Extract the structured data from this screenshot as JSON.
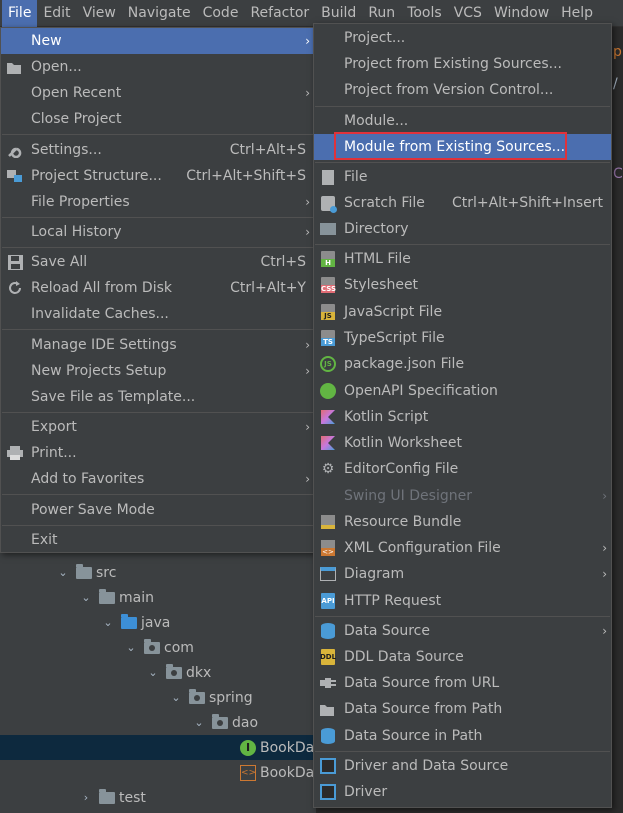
{
  "menubar": [
    {
      "label": "File",
      "active": true
    },
    {
      "label": "Edit"
    },
    {
      "label": "View"
    },
    {
      "label": "Navigate"
    },
    {
      "label": "Code"
    },
    {
      "label": "Refactor"
    },
    {
      "label": "Build"
    },
    {
      "label": "Run"
    },
    {
      "label": "Tools"
    },
    {
      "label": "VCS"
    },
    {
      "label": "Window"
    },
    {
      "label": "Help"
    }
  ],
  "file_menu": {
    "new": "New",
    "open": "Open...",
    "open_recent": "Open Recent",
    "close_project": "Close Project",
    "settings": "Settings...",
    "settings_sc": "Ctrl+Alt+S",
    "project_structure": "Project Structure...",
    "project_structure_sc": "Ctrl+Alt+Shift+S",
    "file_properties": "File Properties",
    "local_history": "Local History",
    "save_all": "Save All",
    "save_all_sc": "Ctrl+S",
    "reload": "Reload All from Disk",
    "reload_sc": "Ctrl+Alt+Y",
    "invalidate": "Invalidate Caches...",
    "manage_ide": "Manage IDE Settings",
    "new_projects_setup": "New Projects Setup",
    "save_template": "Save File as Template...",
    "export": "Export",
    "print": "Print...",
    "add_favorites": "Add to Favorites",
    "power_save": "Power Save Mode",
    "exit": "Exit"
  },
  "new_submenu": {
    "project": "Project...",
    "project_existing": "Project from Existing Sources...",
    "project_vcs": "Project from Version Control...",
    "module": "Module...",
    "module_existing": "Module from Existing Sources...",
    "file": "File",
    "scratch": "Scratch File",
    "scratch_sc": "Ctrl+Alt+Shift+Insert",
    "directory": "Directory",
    "html": "HTML File",
    "stylesheet": "Stylesheet",
    "javascript": "JavaScript File",
    "typescript": "TypeScript File",
    "package_json": "package.json File",
    "openapi": "OpenAPI Specification",
    "kotlin_script": "Kotlin Script",
    "kotlin_worksheet": "Kotlin Worksheet",
    "editorconfig": "EditorConfig File",
    "swing": "Swing UI Designer",
    "resource_bundle": "Resource Bundle",
    "xml_config": "XML Configuration File",
    "diagram": "Diagram",
    "http_request": "HTTP Request",
    "data_source": "Data Source",
    "ddl_source": "DDL Data Source",
    "ds_url": "Data Source from URL",
    "ds_path": "Data Source from Path",
    "ds_in_path": "Data Source in Path",
    "driver_ds": "Driver and Data Source",
    "driver": "Driver"
  },
  "tree": {
    "src": "src",
    "main": "main",
    "java": "java",
    "com": "com",
    "dkx": "dkx",
    "spring": "spring",
    "dao": "dao",
    "bookdao1": "BookDa",
    "bookdao2": "BookDa",
    "test": "test"
  },
  "glyphs": {
    "sub_arrow": "›",
    "tree_down": "⌄",
    "tree_right": "›",
    "iface_letter": "I",
    "editor_edge_1": "p",
    "editor_edge_2": "/",
    "editor_edge_3": "C"
  }
}
